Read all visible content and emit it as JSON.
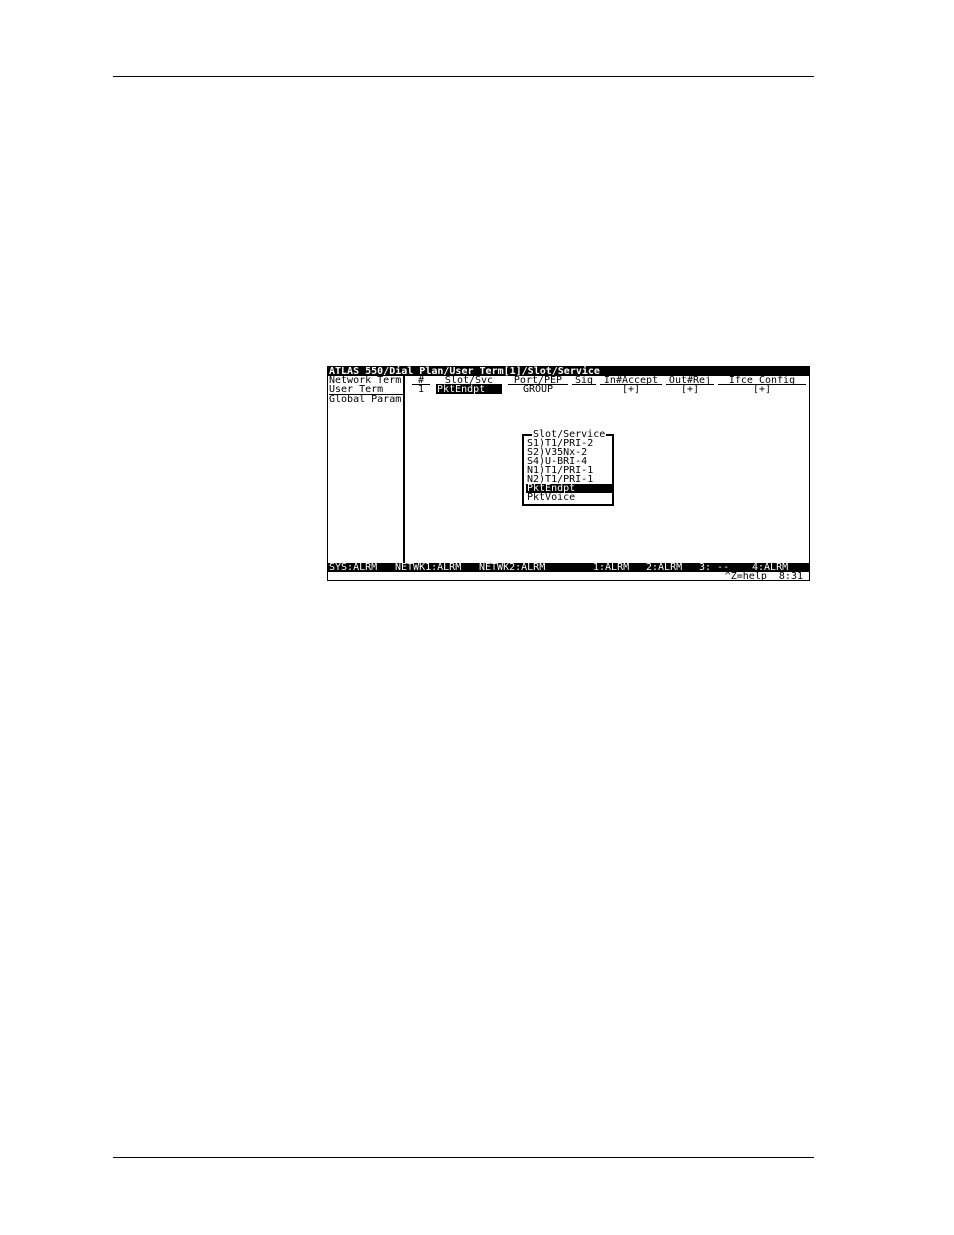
{
  "terminal": {
    "title": "ATLAS 550/Dial Plan/User Term[1]/Slot/Service",
    "menu": [
      "Network Term",
      "User Term",
      "Global Param"
    ],
    "columns": {
      "num": "#",
      "slot_svc": "Slot/Svc",
      "port_pep": "Port/PEP",
      "sig": "Sig",
      "in_accept": "In#Accept",
      "out_rej": "Out#Rej",
      "ifce_config": "Ifce Config"
    },
    "row": {
      "num": "1",
      "slot_svc": "PktEndpt",
      "port_pep": "GROUP",
      "sig": "",
      "in_accept": "[+]",
      "out_rej": "[+]",
      "ifce_config": "[+]"
    },
    "popup": {
      "title": "Slot/Service",
      "options": [
        "S1)T1/PRI-2",
        "S2)V35Nx-2",
        "S4)U-BRI-4",
        "N1)T1/PRI-1",
        "N2)T1/PRI-1",
        "PktEndpt",
        "PktVoice"
      ],
      "selected_index": 5
    },
    "status": {
      "sys": "SYS:ALRM",
      "netwk1": "NETWK1:ALRM",
      "netwk2": "NETWK2:ALRM",
      "p1": "1:ALRM",
      "p2": "2:ALRM",
      "p3": "3: --",
      "p4": "4:ALRM"
    },
    "help": "^Z=help  8:31"
  }
}
